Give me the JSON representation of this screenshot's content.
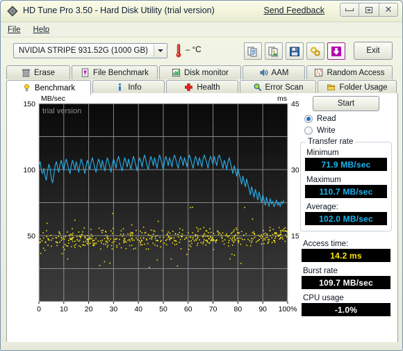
{
  "window": {
    "title": "HD Tune Pro 3.50 - Hard Disk Utility (trial version)",
    "send_feedback": "Send Feedback",
    "minimize_label": "Minimize",
    "maximize_label": "Maximize",
    "close_label": "Close"
  },
  "menu": {
    "items": [
      {
        "label": "File"
      },
      {
        "label": "Help"
      }
    ]
  },
  "toolbar": {
    "drive": "NVIDIA  STRIPE   931.52G (1000 GB)",
    "temperature": "– °C",
    "exit_label": "Exit",
    "buttons": [
      {
        "name": "copy-text-icon"
      },
      {
        "name": "copy-image-icon"
      },
      {
        "name": "save-icon"
      },
      {
        "name": "settings-icon"
      },
      {
        "name": "download-update-icon"
      }
    ]
  },
  "tabs": {
    "row1": [
      {
        "label": "Erase",
        "icon": "trash-icon",
        "active": false
      },
      {
        "label": "File Benchmark",
        "icon": "document-icon",
        "active": false
      },
      {
        "label": "Disk monitor",
        "icon": "bar-chart-icon",
        "active": false
      },
      {
        "label": "AAM",
        "icon": "speaker-icon",
        "active": false
      },
      {
        "label": "Random Access",
        "icon": "scatter-icon",
        "active": false
      }
    ],
    "row2": [
      {
        "label": "Benchmark",
        "icon": "bulb-icon",
        "active": true
      },
      {
        "label": "Info",
        "icon": "info-icon",
        "active": false
      },
      {
        "label": "Health",
        "icon": "cross-icon",
        "active": false
      },
      {
        "label": "Error Scan",
        "icon": "magnifier-icon",
        "active": false
      },
      {
        "label": "Folder Usage",
        "icon": "folder-icon",
        "active": false
      }
    ]
  },
  "benchmark": {
    "start_label": "Start",
    "mode_read": "Read",
    "mode_write": "Write",
    "mode_selected": "Read",
    "transfer_rate_group": "Transfer rate",
    "minimum_label": "Minimum",
    "minimum_value": "71.9 MB/sec",
    "maximum_label": "Maximum",
    "maximum_value": "110.7 MB/sec",
    "average_label": "Average:",
    "average_value": "102.0 MB/sec",
    "access_time_label": "Access time:",
    "access_time_value": "14.2 ms",
    "burst_rate_label": "Burst rate",
    "burst_rate_value": "109.7 MB/sec",
    "cpu_usage_label": "CPU usage",
    "cpu_usage_value": "-1.0%"
  },
  "colors": {
    "transfer_curve": "#29a8e0",
    "access_dots": "#f5e513",
    "lcd_cyan": "#19b5f0",
    "lcd_yellow": "#ffe400",
    "plot_bg_top": "#0a0a0a",
    "plot_bg_bottom": "#3a3a3a",
    "grid": "#9a9a9a"
  },
  "chart_data": {
    "type": "line",
    "title": "",
    "watermark": "trial version",
    "ylabel": "MB/sec",
    "y2label": "ms",
    "xlabel": "",
    "xlim": [
      0,
      100
    ],
    "ylim": [
      0,
      150
    ],
    "y2lim": [
      0,
      45
    ],
    "grid": true,
    "legend": "none",
    "xticks": [
      0,
      10,
      20,
      30,
      40,
      50,
      60,
      70,
      80,
      90,
      100
    ],
    "xticklabels": [
      "0",
      "10",
      "20",
      "30",
      "40",
      "50",
      "60",
      "70",
      "80",
      "90",
      "100%"
    ],
    "yticks": [
      50,
      100,
      150
    ],
    "yticklabels": [
      "50",
      "100",
      "150"
    ],
    "y2ticks": [
      15,
      30,
      45
    ],
    "y2ticklabels": [
      "15",
      "30",
      "45"
    ],
    "series": [
      {
        "name": "Transfer rate",
        "axis": "left",
        "unit": "MB/sec",
        "color": "#29a8e0",
        "x": [
          0,
          0.5,
          1,
          1.5,
          2,
          2.5,
          3,
          3.5,
          4,
          4.5,
          5,
          5.5,
          6,
          6.5,
          7,
          7.5,
          8,
          8.5,
          9,
          9.5,
          10,
          10.5,
          11,
          11.5,
          12,
          12.5,
          13,
          13.5,
          14,
          14.5,
          15,
          15.5,
          16,
          16.5,
          17,
          17.5,
          18,
          18.5,
          19,
          19.5,
          20,
          20.5,
          21,
          21.5,
          22,
          22.5,
          23,
          23.5,
          24,
          24.5,
          25,
          25.5,
          26,
          26.5,
          27,
          27.5,
          28,
          28.5,
          29,
          29.5,
          30,
          30.5,
          31,
          31.5,
          32,
          32.5,
          33,
          33.5,
          34,
          34.5,
          35,
          35.5,
          36,
          36.5,
          37,
          37.5,
          38,
          38.5,
          39,
          39.5,
          40,
          40.5,
          41,
          41.5,
          42,
          42.5,
          43,
          43.5,
          44,
          44.5,
          45,
          45.5,
          46,
          46.5,
          47,
          47.5,
          48,
          48.5,
          49,
          49.5,
          50,
          50.5,
          51,
          51.5,
          52,
          52.5,
          53,
          53.5,
          54,
          54.5,
          55,
          55.5,
          56,
          56.5,
          57,
          57.5,
          58,
          58.5,
          59,
          59.5,
          60,
          60.5,
          61,
          61.5,
          62,
          62.5,
          63,
          63.5,
          64,
          64.5,
          65,
          65.5,
          66,
          66.5,
          67,
          67.5,
          68,
          68.5,
          69,
          69.5,
          70,
          70.5,
          71,
          71.5,
          72,
          72.5,
          73,
          73.5,
          74,
          74.5,
          75,
          75.5,
          76,
          76.5,
          77,
          77.5,
          78,
          78.5,
          79,
          79.5,
          80,
          80.5,
          81,
          81.5,
          82,
          82.5,
          83,
          83.5,
          84,
          84.5,
          85,
          85.5,
          86,
          86.5,
          87,
          87.5,
          88,
          88.5,
          89,
          89.5,
          90,
          90.5,
          91,
          91.5,
          92,
          92.5,
          93,
          93.5,
          94,
          94.5,
          95,
          95.5,
          96,
          96.5,
          97,
          97.5,
          98,
          98.5,
          99,
          99.5,
          100
        ],
        "y": [
          103,
          106,
          99,
          97,
          101,
          95,
          92,
          99,
          104,
          101,
          93,
          90,
          96,
          103,
          106,
          102,
          98,
          104,
          107,
          103,
          99,
          105,
          108,
          104,
          100,
          97,
          103,
          107,
          104,
          100,
          106,
          102,
          98,
          104,
          108,
          105,
          101,
          97,
          103,
          107,
          104,
          100,
          106,
          109,
          105,
          101,
          98,
          104,
          108,
          105,
          101,
          107,
          103,
          99,
          105,
          109,
          106,
          102,
          98,
          104,
          108,
          105,
          101,
          107,
          110,
          106,
          102,
          99,
          105,
          109,
          106,
          102,
          108,
          104,
          100,
          106,
          110,
          107,
          103,
          99,
          105,
          109,
          106,
          102,
          108,
          111,
          107,
          103,
          100,
          106,
          110,
          107,
          103,
          109,
          105,
          101,
          107,
          111,
          108,
          104,
          100,
          106,
          110,
          107,
          103,
          109,
          106,
          102,
          108,
          111,
          108,
          104,
          101,
          107,
          110,
          107,
          103,
          109,
          106,
          102,
          108,
          111,
          108,
          104,
          101,
          107,
          110,
          107,
          103,
          109,
          106,
          102,
          108,
          111,
          108,
          105,
          101,
          107,
          110,
          107,
          104,
          110,
          106,
          103,
          109,
          111,
          108,
          105,
          101,
          107,
          104,
          100,
          106,
          109,
          105,
          101,
          97,
          103,
          99,
          95,
          101,
          97,
          93,
          89,
          95,
          91,
          87,
          93,
          89,
          85,
          81,
          87,
          83,
          79,
          85,
          81,
          77,
          83,
          79,
          75,
          81,
          77,
          73,
          79,
          75,
          72,
          78,
          74,
          76,
          72,
          74,
          77,
          73,
          75,
          72,
          76,
          74,
          77
        ]
      },
      {
        "name": "Access time",
        "axis": "right",
        "unit": "ms",
        "type": "scatter",
        "color": "#f5e513",
        "mean_ms": 14.2,
        "range_ms": [
          7.5,
          22.5
        ],
        "note": "~500 scattered samples across 0-100%, densest near 13-16 ms"
      }
    ]
  }
}
